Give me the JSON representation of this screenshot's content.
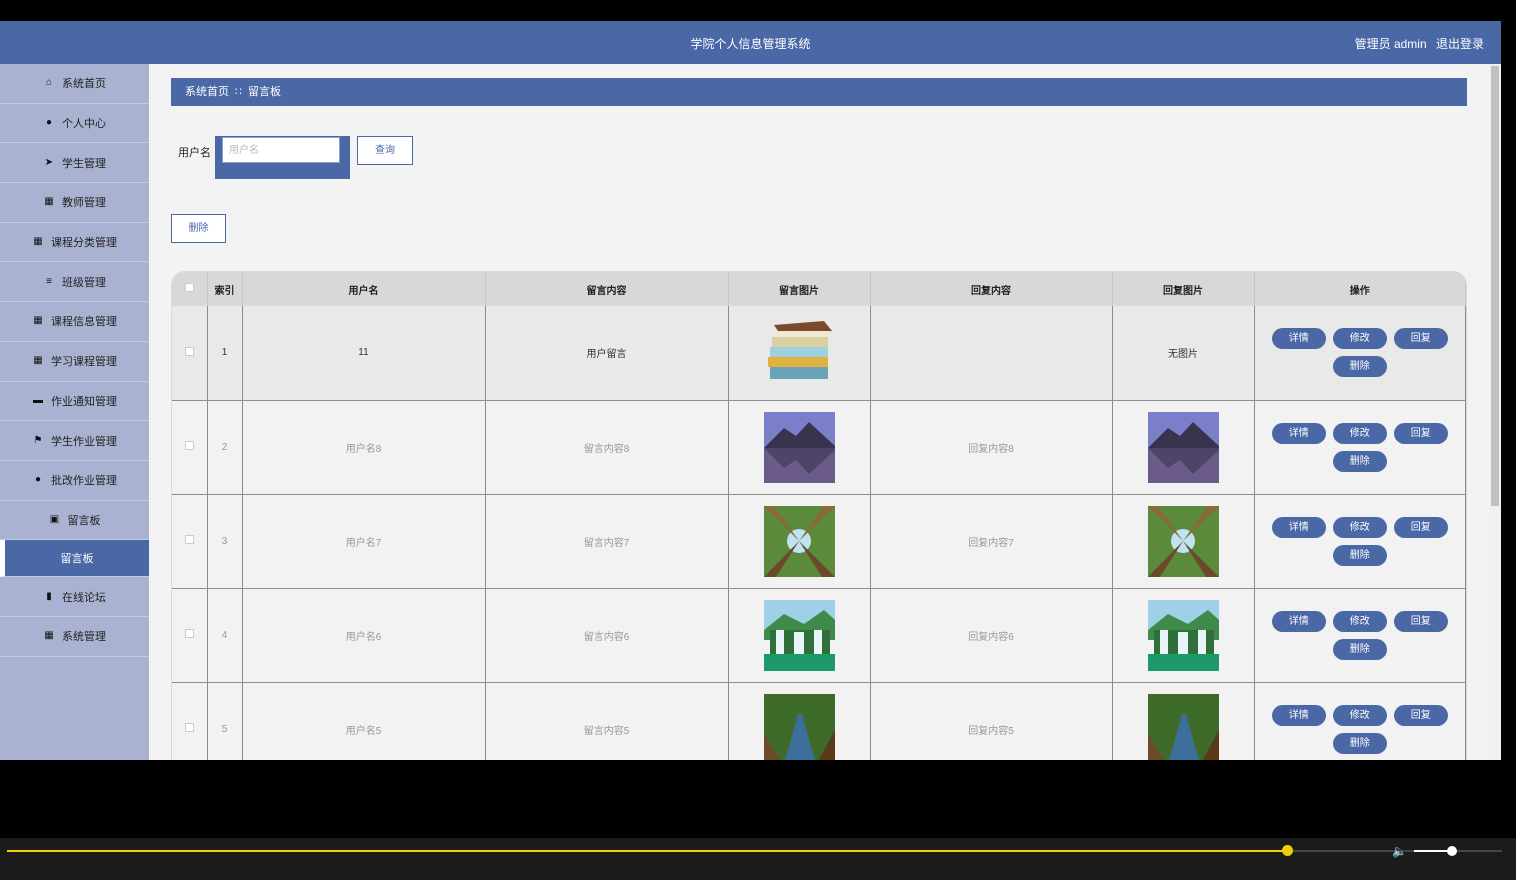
{
  "header": {
    "title": "学院个人信息管理系统",
    "role": "管理员 admin",
    "logout": "退出登录"
  },
  "sidebar": {
    "items": [
      {
        "label": "系统首页",
        "icon": "home-icon"
      },
      {
        "label": "个人中心",
        "icon": "user-icon"
      },
      {
        "label": "学生管理",
        "icon": "send-icon"
      },
      {
        "label": "教师管理",
        "icon": "grid-icon"
      },
      {
        "label": "课程分类管理",
        "icon": "grid-icon"
      },
      {
        "label": "班级管理",
        "icon": "list-icon"
      },
      {
        "label": "课程信息管理",
        "icon": "grid-icon"
      },
      {
        "label": "学习课程管理",
        "icon": "grid-icon"
      },
      {
        "label": "作业通知管理",
        "icon": "monitor-icon"
      },
      {
        "label": "学生作业管理",
        "icon": "flag-icon"
      },
      {
        "label": "批改作业管理",
        "icon": "bulb-icon"
      },
      {
        "label": "留言板",
        "icon": "board-icon"
      }
    ],
    "sub_active": "留言板",
    "bottom_items": [
      {
        "label": "在线论坛",
        "icon": "chart-icon"
      },
      {
        "label": "系统管理",
        "icon": "grid-icon"
      }
    ]
  },
  "breadcrumb": {
    "home": "系统首页",
    "sep": "∷",
    "current": "留言板"
  },
  "search": {
    "label": "用户名",
    "placeholder": "用户名",
    "button": "查询"
  },
  "actions": {
    "delete": "删除"
  },
  "table": {
    "headers": [
      "索引",
      "用户名",
      "留言内容",
      "留言图片",
      "回复内容",
      "回复图片",
      "操作"
    ],
    "rows": [
      {
        "index": "1",
        "username": "11",
        "message": "用户留言",
        "image": "books",
        "reply": "",
        "reply_image": "无图片"
      },
      {
        "index": "2",
        "username": "用户名8",
        "message": "留言内容8",
        "image": "mountain-lake",
        "reply": "回复内容8",
        "reply_image": "mountain-lake"
      },
      {
        "index": "3",
        "username": "用户名7",
        "message": "留言内容7",
        "image": "forest",
        "reply": "回复内容7",
        "reply_image": "forest"
      },
      {
        "index": "4",
        "username": "用户名6",
        "message": "留言内容6",
        "image": "waterfall",
        "reply": "回复内容6",
        "reply_image": "waterfall"
      },
      {
        "index": "5",
        "username": "用户名5",
        "message": "留言内容5",
        "image": "river-forest",
        "reply": "回复内容5",
        "reply_image": "river-forest"
      }
    ],
    "ops": {
      "detail": "详情",
      "edit": "修改",
      "reply": "回复",
      "delete": "删除"
    }
  },
  "player": {
    "progress": 0.857,
    "volume": 0.43
  }
}
